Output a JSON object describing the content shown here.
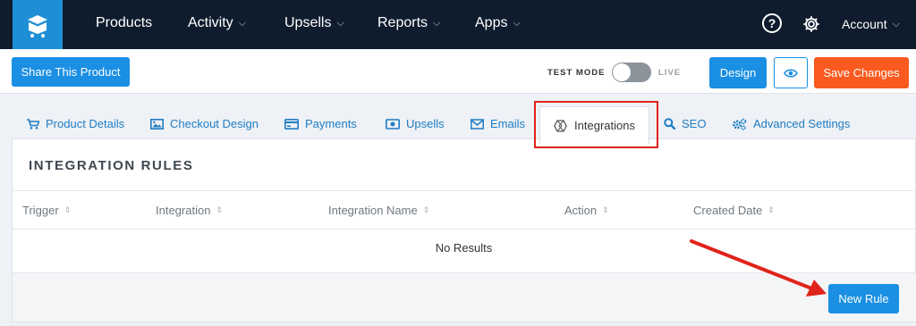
{
  "nav": {
    "items": [
      {
        "label": "Products",
        "has_dropdown": false
      },
      {
        "label": "Activity",
        "has_dropdown": true
      },
      {
        "label": "Upsells",
        "has_dropdown": true
      },
      {
        "label": "Reports",
        "has_dropdown": true
      },
      {
        "label": "Apps",
        "has_dropdown": true
      }
    ],
    "help_glyph": "?",
    "account_label": "Account",
    "chevron": "⌵"
  },
  "toolbar": {
    "share_label": "Share This Product",
    "test_mode_label": "TEST MODE",
    "live_label": "LIVE",
    "test_mode_on": false,
    "design_label": "Design",
    "save_label": "Save Changes"
  },
  "tabs": [
    {
      "label": "Product Details",
      "icon": "cart-icon"
    },
    {
      "label": "Checkout Design",
      "icon": "image-icon"
    },
    {
      "label": "Payments",
      "icon": "credit-card-icon"
    },
    {
      "label": "Upsells",
      "icon": "money-icon"
    },
    {
      "label": "Emails",
      "icon": "envelope-icon"
    },
    {
      "label": "Integrations",
      "icon": "hexagon-icon",
      "active": true
    },
    {
      "label": "SEO",
      "icon": "search-icon"
    },
    {
      "label": "Advanced Settings",
      "icon": "cogs-icon"
    }
  ],
  "panel": {
    "title": "INTEGRATION RULES",
    "columns": [
      "Trigger",
      "Integration",
      "Integration Name",
      "Action",
      "Created Date"
    ],
    "sort_glyph": "⇕",
    "empty_text": "No Results",
    "new_rule_label": "New Rule"
  },
  "colors": {
    "nav_bg": "#0f1c2e",
    "accent_blue": "#1a8fe3",
    "save_orange": "#fa5a1f",
    "tab_link": "#1f7dc4",
    "highlight_red": "#e0231b"
  }
}
